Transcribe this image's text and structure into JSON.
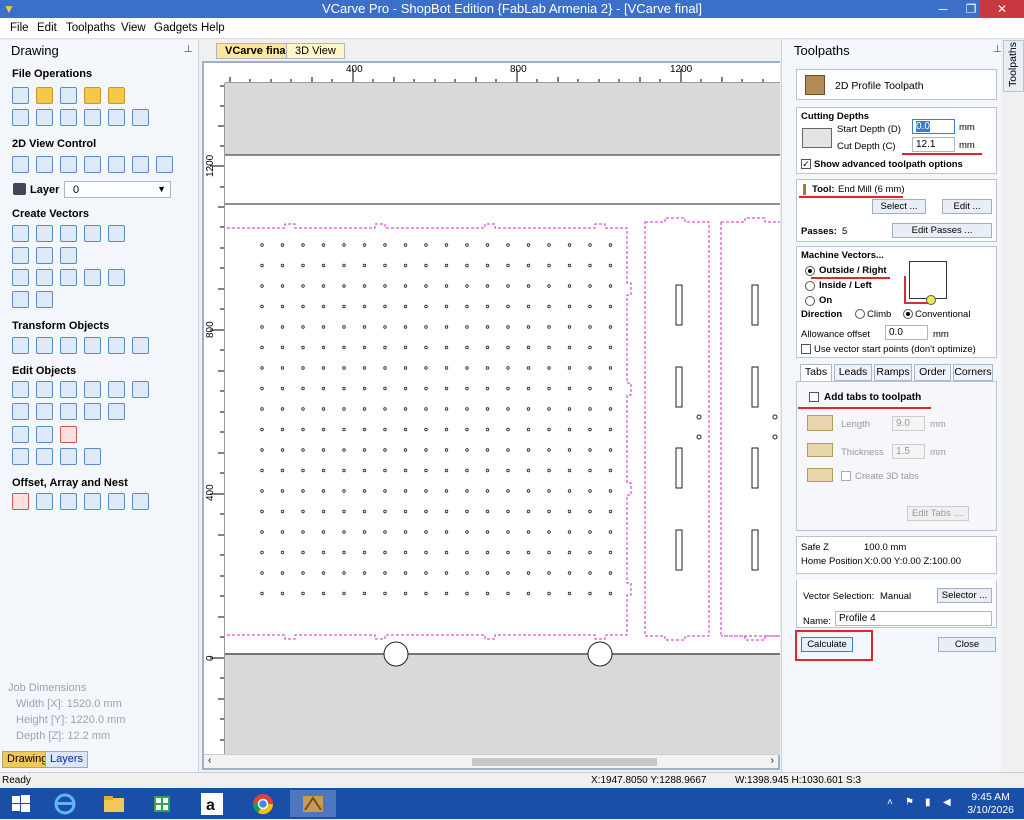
{
  "window": {
    "title": "VCarve Pro - ShopBot Edition {FabLab Armenia 2} - [VCarve final]"
  },
  "menu": [
    "File",
    "Edit",
    "Toolpaths",
    "View",
    "Gadgets",
    "Help"
  ],
  "drawing_panel": {
    "title": "Drawing",
    "sections": [
      "File Operations",
      "2D View Control",
      "Create Vectors",
      "Transform Objects",
      "Edit Objects",
      "Offset, Array and Nest"
    ],
    "layer_label": "Layer",
    "layer_value": "0",
    "job_dimensions": {
      "title": "Job Dimensions",
      "width": "Width  [X]: 1520.0 mm",
      "height": "Height [Y]: 1220.0 mm",
      "depth": "Depth  [Z]: 12.2 mm"
    },
    "bottom_tabs": [
      "Drawing",
      "Layers"
    ]
  },
  "doc_tabs": [
    "VCarve final",
    "3D View"
  ],
  "rulers": {
    "x_labels": [
      "400",
      "800",
      "1200"
    ],
    "y_labels": [
      "1200",
      "800",
      "400",
      "0"
    ]
  },
  "toolpaths_panel": {
    "title": "Toolpaths",
    "toolpath_name": "2D Profile Toolpath",
    "cutting_depths": {
      "title": "Cutting Depths",
      "start_label": "Start Depth (D)",
      "start_value": "0.0",
      "cut_label": "Cut Depth (C)",
      "cut_value": "12.1",
      "unit": "mm",
      "show_advanced": "Show advanced toolpath options"
    },
    "tool": {
      "label": "Tool:",
      "value": "End Mill (6 mm)",
      "select": "Select ...",
      "edit": "Edit ...",
      "passes_label": "Passes:",
      "passes_value": "5",
      "edit_passes": "Edit Passes ..."
    },
    "machine_vectors": {
      "title": "Machine Vectors...",
      "outside": "Outside / Right",
      "inside": "Inside / Left",
      "on": "On",
      "direction_label": "Direction",
      "climb": "Climb",
      "conventional": "Conventional",
      "allowance_label": "Allowance offset",
      "allowance_value": "0.0",
      "unit": "mm",
      "use_start_points": "Use vector start points (don't optimize)"
    },
    "tabs": [
      "Tabs",
      "Leads",
      "Ramps",
      "Order",
      "Corners"
    ],
    "tabs_panel": {
      "add_tabs": "Add tabs to toolpath",
      "length_label": "Length",
      "length_value": "9.0",
      "thickness_label": "Thickness",
      "thickness_value": "1.5",
      "unit": "mm",
      "create_3d": "Create 3D tabs",
      "edit_tabs": "Edit Tabs ...."
    },
    "safe_z_label": "Safe Z",
    "safe_z_value": "100.0 mm",
    "home_label": "Home Position",
    "home_value": "X:0.00 Y:0.00 Z:100.00",
    "vector_selection_label": "Vector Selection:",
    "vector_selection_value": "Manual",
    "selector": "Selector ...",
    "name_label": "Name:",
    "name_value": "Profile 4",
    "calculate": "Calculate",
    "close": "Close",
    "side_tab": "Toolpaths"
  },
  "status": {
    "left": "Ready",
    "coords": "X:1947.8050 Y:1288.9667",
    "size": "W:1398.945  H:1030.601  S:3"
  },
  "taskbar": {
    "time": "9:45 AM",
    "date": "3/10/2026"
  },
  "colors": {
    "accent": "#3c6fc8",
    "highlight": "#e0262b",
    "vector_dash": "#d22bd2"
  }
}
